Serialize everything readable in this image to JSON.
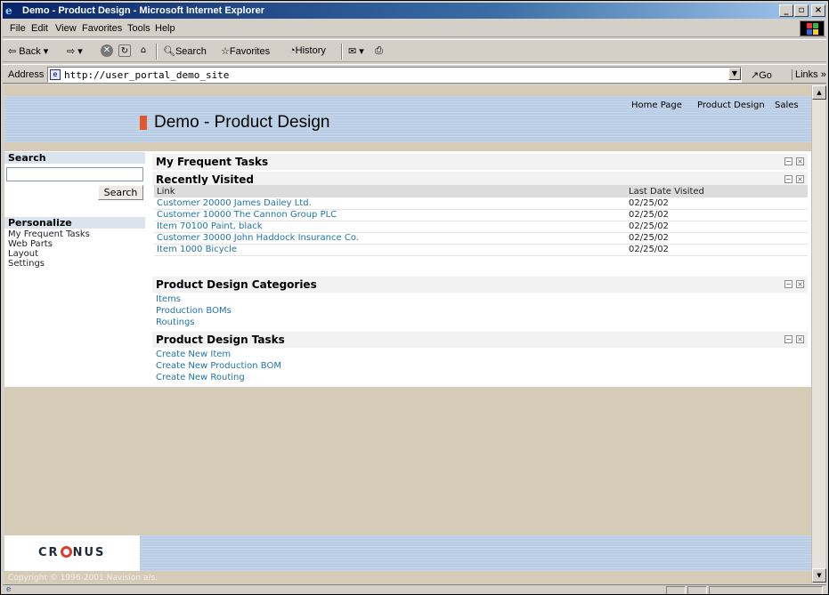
{
  "window": {
    "title": "Demo - Product Design - Microsoft Internet Explorer",
    "minimize": "_",
    "maximize": "▫",
    "close": "×"
  },
  "menu": [
    "File",
    "Edit",
    "View",
    "Favorites",
    "Tools",
    "Help"
  ],
  "toolbar": {
    "back": "Back",
    "search": "Search",
    "favorites": "Favorites",
    "history": "History"
  },
  "address": {
    "label": "Address",
    "url": "http://user_portal_demo_site",
    "go": "Go",
    "links": "Links »"
  },
  "header": {
    "title": "Demo - Product Design",
    "nav": [
      "Home Page",
      "Product Design",
      "Sales"
    ]
  },
  "sidebar": {
    "search_heading": "Search",
    "search_button": "Search",
    "search_value": "",
    "personalize_heading": "Personalize",
    "links": [
      "My Frequent Tasks",
      "Web Parts",
      "Layout",
      "Settings"
    ]
  },
  "sections": {
    "frequent": {
      "title": "My Frequent Tasks"
    },
    "recent": {
      "title": "Recently Visited",
      "columns": [
        "Link",
        "Last Date Visited"
      ],
      "rows": [
        {
          "link": "Customer 20000 James Dailey Ltd.",
          "date": "02/25/02"
        },
        {
          "link": "Customer 10000 The Cannon Group PLC",
          "date": "02/25/02"
        },
        {
          "link": "Item 70100 Paint, black",
          "date": "02/25/02"
        },
        {
          "link": "Customer 30000 John Haddock Insurance Co.",
          "date": "02/25/02"
        },
        {
          "link": "Item 1000 Bicycle",
          "date": "02/25/02"
        }
      ]
    },
    "categories": {
      "title": "Product Design Categories",
      "links": [
        "Items",
        "Production BOMs",
        "Routings"
      ]
    },
    "tasks": {
      "title": "Product Design Tasks",
      "links": [
        "Create New Item",
        "Create New Production BOM",
        "Create New Routing"
      ]
    }
  },
  "controls": {
    "minimize": "−",
    "close": "×"
  },
  "footer": {
    "logo_left": "CR",
    "logo_right": "NUS",
    "copyright": "Copyright © 1996-2001 Navision a/s."
  },
  "colors": {
    "title_bar": "#0a246a",
    "header_band": "#b9cde5",
    "accent": "#e4572e",
    "link": "#1f74a8",
    "background": "#d6cbb6"
  },
  "icons": [
    "ie-icon",
    "back-icon",
    "forward-icon",
    "stop-icon",
    "refresh-icon",
    "home-icon",
    "search-icon",
    "favorites-icon",
    "history-icon",
    "mail-icon",
    "print-icon",
    "windows-logo-icon",
    "page-icon",
    "go-arrow-icon"
  ]
}
